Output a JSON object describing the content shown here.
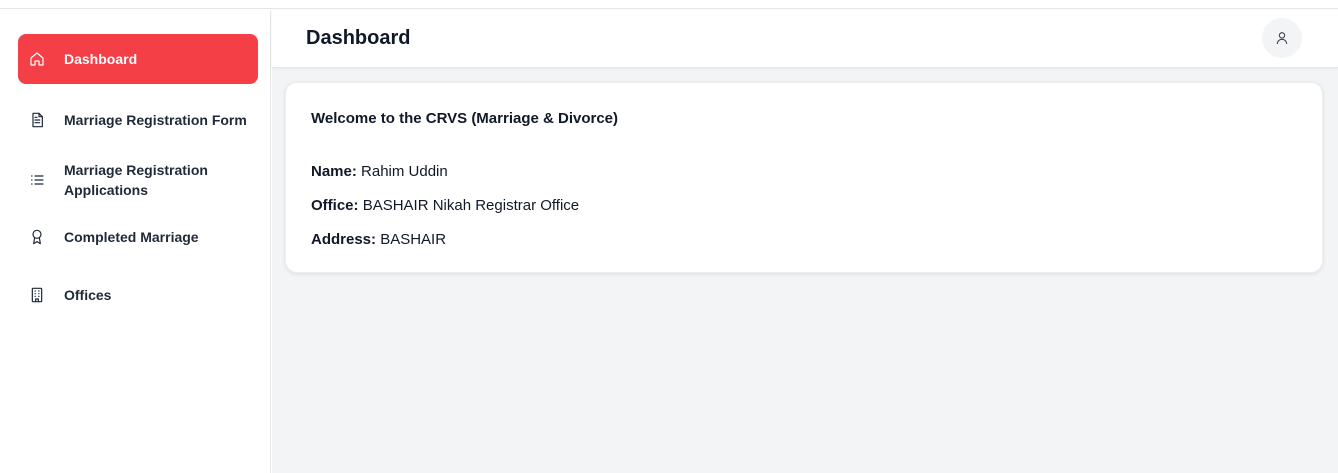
{
  "sidebar": {
    "items": [
      {
        "label": "Dashboard",
        "icon": "home-icon",
        "active": true
      },
      {
        "label": "Marriage Registration Form",
        "icon": "document-icon",
        "active": false
      },
      {
        "label": "Marriage Registration Applications",
        "icon": "list-icon",
        "active": false
      },
      {
        "label": "Completed Marriage",
        "icon": "award-icon",
        "active": false
      },
      {
        "label": "Offices",
        "icon": "building-icon",
        "active": false
      }
    ]
  },
  "header": {
    "title": "Dashboard",
    "avatar_icon": "user-icon"
  },
  "card": {
    "welcome": "Welcome to the CRVS (Marriage & Divorce)",
    "name_label": "Name:",
    "name_value": "Rahim Uddin",
    "office_label": "Office:",
    "office_value": "BASHAIR Nikah Registrar Office",
    "address_label": "Address:",
    "address_value": "BASHAIR"
  },
  "colors": {
    "accent": "#f43f47",
    "background": "#f3f4f6"
  }
}
